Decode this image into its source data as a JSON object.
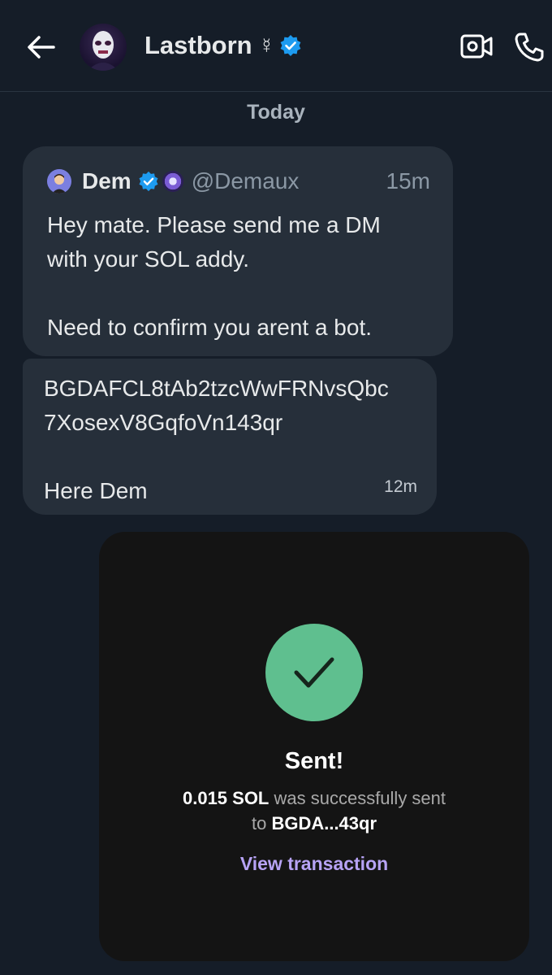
{
  "header": {
    "name": "Lastborn",
    "symbol": "☿",
    "back_icon": "arrow-left-icon",
    "video_icon": "video-camera-icon",
    "phone_icon": "phone-icon"
  },
  "date_separator": "Today",
  "messages": [
    {
      "quote": {
        "name": "Dem",
        "handle": "@Demaux",
        "time": "15m"
      },
      "text": "Hey mate. Please send me a DM\nwith your SOL addy.\n\nNeed to confirm you arent a bot."
    },
    {
      "text": "BGDAFCL8tAb2tzcWwFRNvsQbc\n7XosexV8GqfoVn143qr\n\nHere Dem",
      "time": "12m"
    }
  ],
  "transaction_card": {
    "status": "Sent!",
    "amount": "0.015 SOL",
    "mid_text": " was successfully sent",
    "to_prefix": "to ",
    "recipient": "BGDA...43qr",
    "link": "View transaction"
  },
  "colors": {
    "background": "#151d28",
    "bubble": "#262f3a",
    "verified": "#1d9bf0",
    "success": "#5fbf8f",
    "link": "#b7a3f5"
  }
}
